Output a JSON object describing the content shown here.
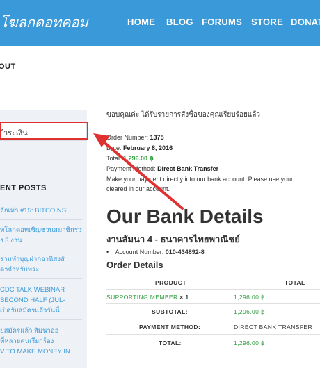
{
  "header": {
    "logo_text": "โฆลกดอทคอม",
    "nav": [
      "HOME",
      "BLOG",
      "FORUMS",
      "STORE",
      "DONAT"
    ]
  },
  "breadcrumb": {
    "text": "OUT"
  },
  "sidebar": {
    "box_text": "ำระเงิน",
    "recent_posts_heading": "ENT POSTS",
    "posts": [
      "ลักเม่า #15: BITCOINS!",
      "ทโลกดอทเชิญชวนสมาชิกร่วม",
      "ง 3 งาน",
      "รวมทำบุญฝากอานิสงส์",
      "ดาจำหรับพระ",
      "CDC TALK WEBINAR",
      "SECOND HALF (JUL-",
      "เปิดรับสมัครแล้ววันนี้",
      "ยสมัครแล้ว สัมนาออ",
      "ที่หลายคนเรียกร้อง",
      "V TO MAKE MONEY IN"
    ]
  },
  "order": {
    "thanks": "ขอบคุณค่ะ ได้รับรายการสั่งซื้อของคุณเรียบร้อยแล้ว",
    "order_number_label": "Order Number:",
    "order_number": "1375",
    "date_label": "Date:",
    "date": "February 8, 2016",
    "total_label": "Total:",
    "total": "1,296.00 ฿",
    "payment_label": "Payment Method:",
    "payment": "Direct Bank Transfer",
    "note1": "Make your payment directly into our bank account. Please use your",
    "note2": "cleared in our account."
  },
  "bank": {
    "heading": "Our Bank Details",
    "name": "งานสัมนา 4 - ธนาคารไทยพาณิชย์",
    "account_label": "Account Number:",
    "account_number": "010-434892-8"
  },
  "order_details": {
    "heading": "Order Details",
    "col_product": "PRODUCT",
    "col_total": "TOTAL",
    "item_name": "SUPPORTING MEMBER",
    "item_qty": "× 1",
    "item_total": "1,296.00 ฿",
    "subtotal_label": "SUBTOTAL:",
    "subtotal": "1,296.00 ฿",
    "payment_label": "PAYMENT METHOD:",
    "payment": "DIRECT BANK TRANSFER",
    "total_label": "TOTAL:",
    "total": "1,296.00 ฿"
  },
  "colors": {
    "header": "#3a9ad9",
    "accent": "#2e9e3e",
    "annotation": "#e03030"
  }
}
